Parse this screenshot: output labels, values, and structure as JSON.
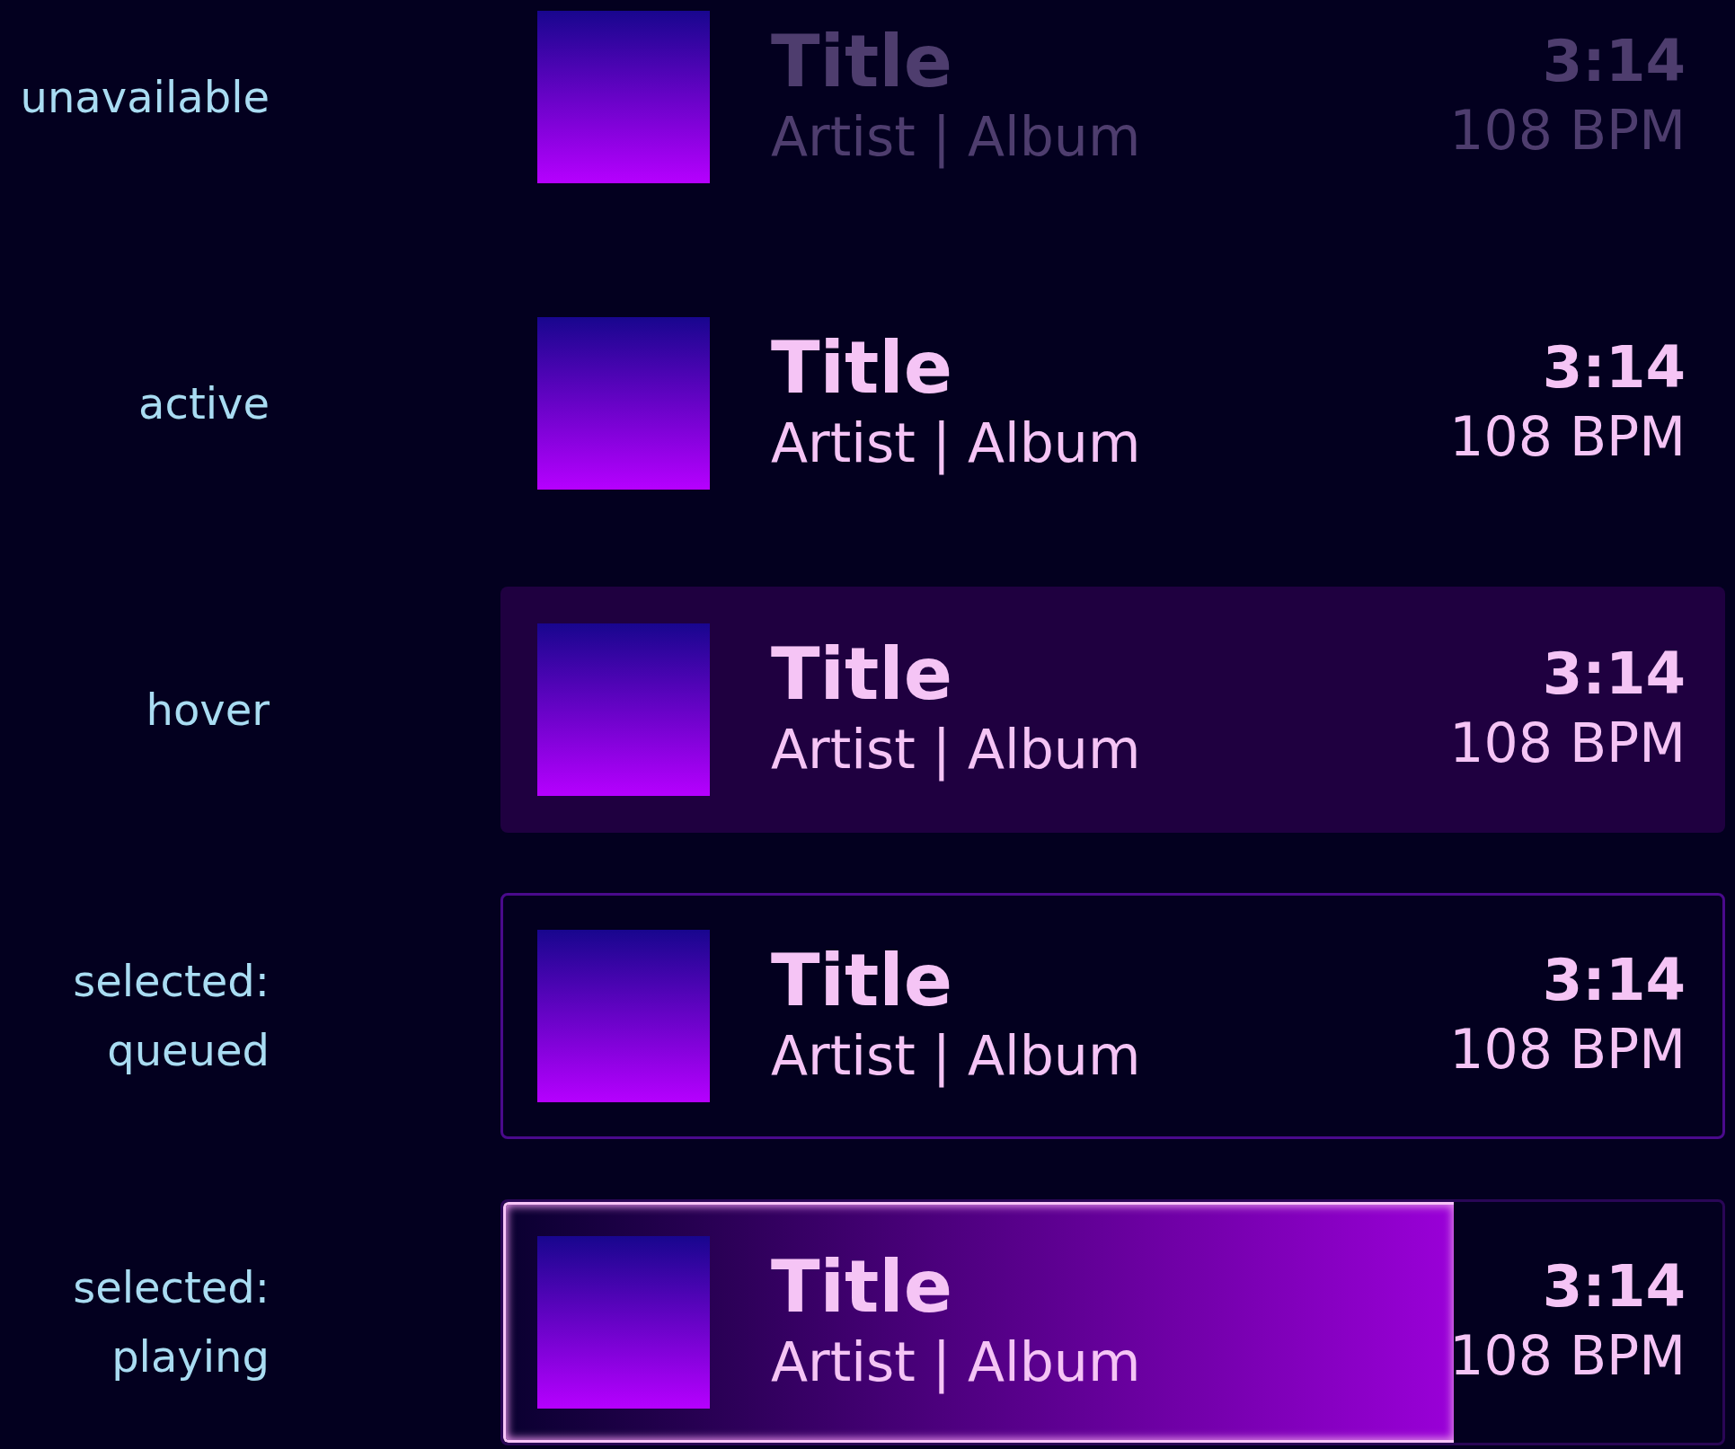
{
  "tracks": [
    {
      "label": "unavailable",
      "kind": "unavailable",
      "selected": false,
      "title": "Title",
      "subtitle": "Artist | Album",
      "duration": "3:14",
      "bpm": "108 BPM"
    },
    {
      "label": "active",
      "kind": "active",
      "selected": false,
      "title": "Title",
      "subtitle": "Artist | Album",
      "duration": "3:14",
      "bpm": "108 BPM"
    },
    {
      "label": "hover",
      "kind": "hover",
      "selected": false,
      "title": "Title",
      "subtitle": "Artist | Album",
      "duration": "3:14",
      "bpm": "108 BPM"
    },
    {
      "label": "selected: queued",
      "kind": "queued",
      "selected": true,
      "title": "Title",
      "subtitle": "Artist | Album",
      "duration": "3:14",
      "bpm": "108 BPM"
    },
    {
      "label": "selected: playing",
      "kind": "playing",
      "selected": true,
      "level": 0.78,
      "title": "Title",
      "subtitle": "Artist | Album",
      "duration": "3:14",
      "bpm": "108 BPM"
    }
  ]
}
